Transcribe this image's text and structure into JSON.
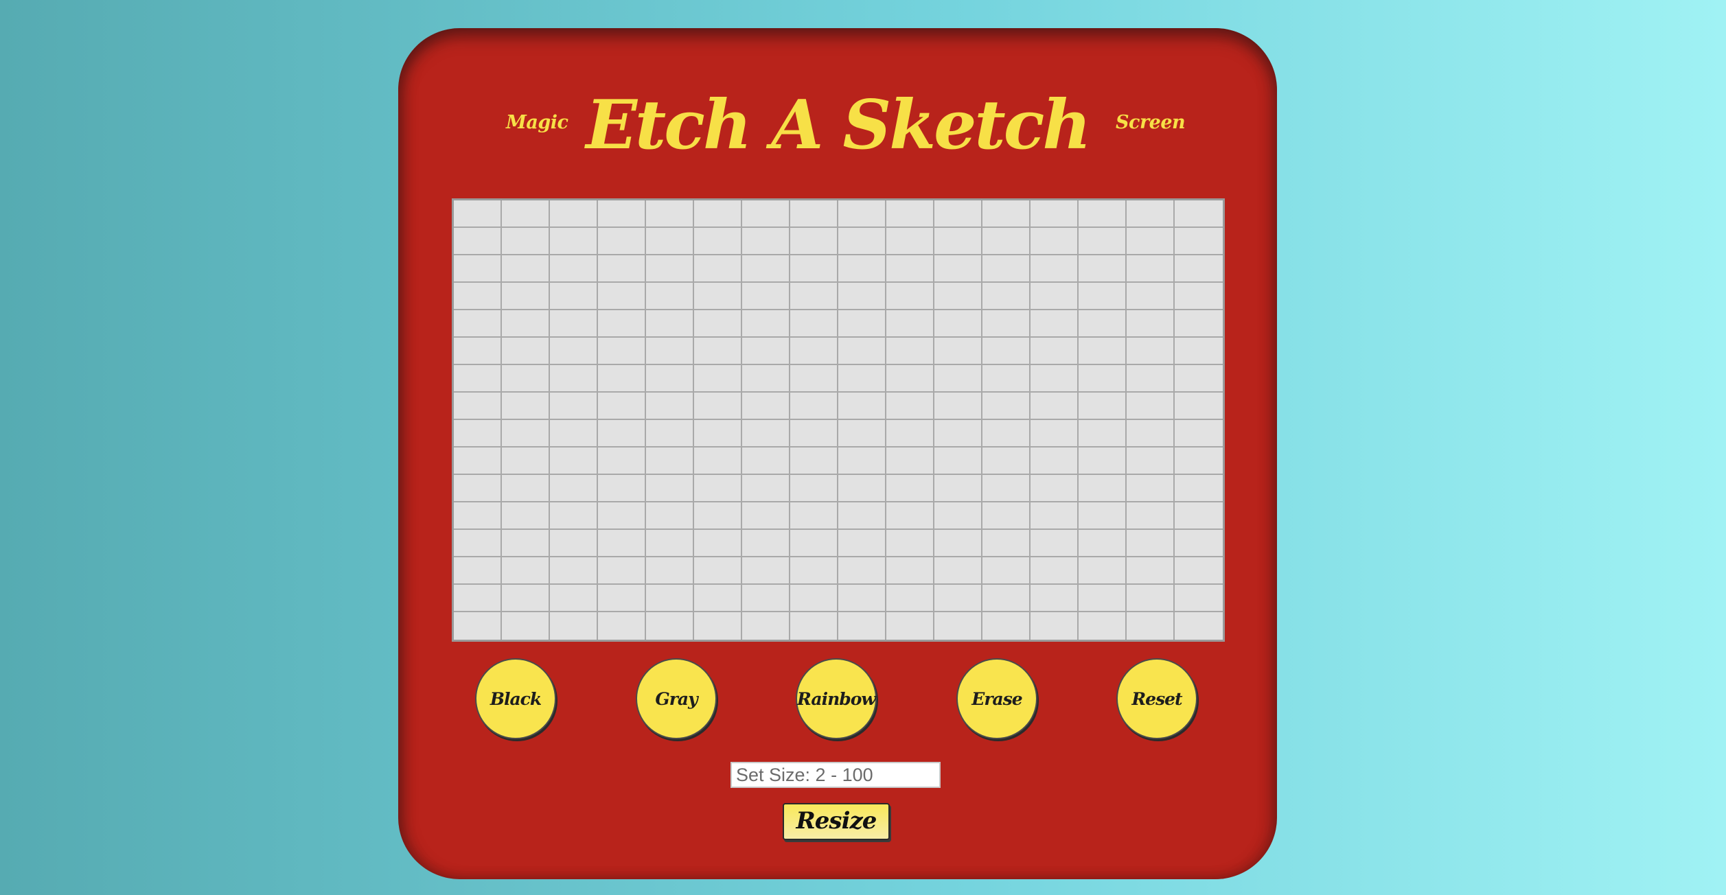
{
  "header": {
    "left_word": "Magic",
    "title": "Etch A Sketch",
    "right_word": "Screen"
  },
  "grid": {
    "size": 16
  },
  "buttons": [
    {
      "label": "Black"
    },
    {
      "label": "Gray"
    },
    {
      "label": "Rainbow"
    },
    {
      "label": "Erase"
    },
    {
      "label": "Reset"
    }
  ],
  "size_input": {
    "placeholder": "Set Size: 2 - 100",
    "value": ""
  },
  "resize_button": {
    "label": "Resize"
  },
  "colors": {
    "body_red": "#b8231b",
    "accent_yellow": "#f7e047",
    "grid_cell": "#e2e2e2"
  }
}
